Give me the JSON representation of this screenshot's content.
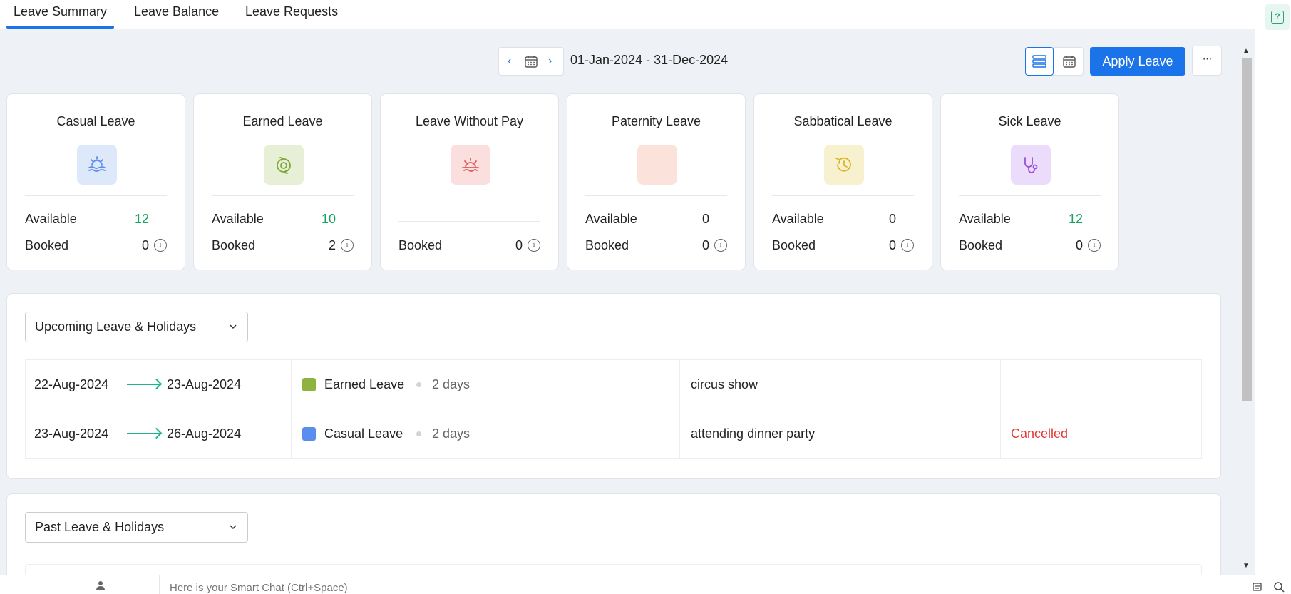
{
  "tabs": [
    {
      "label": "Leave Summary",
      "active": true
    },
    {
      "label": "Leave Balance",
      "active": false
    },
    {
      "label": "Leave Requests",
      "active": false
    }
  ],
  "date_range": "01-Jan-2024 - 31-Dec-2024",
  "apply_label": "Apply Leave",
  "more_label": "···",
  "card_labels": {
    "available": "Available",
    "booked": "Booked"
  },
  "cards": [
    {
      "title": "Casual Leave",
      "icon": "sunrise-waves-icon",
      "icon_bg": "#dde8fb",
      "icon_color": "#5b8def",
      "available": "12",
      "available_color": "green",
      "booked": "0"
    },
    {
      "title": "Earned Leave",
      "icon": "refresh-target-icon",
      "icon_bg": "#e7efd7",
      "icon_color": "#7fa83a",
      "available": "10",
      "available_color": "green",
      "booked": "2"
    },
    {
      "title": "Leave Without Pay",
      "icon": "sunset-icon",
      "icon_bg": "#fbdfdf",
      "icon_color": "#e05a5a",
      "available": null,
      "booked": "0"
    },
    {
      "title": "Paternity Leave",
      "icon": "blank-icon",
      "icon_bg": "#fbe3db",
      "icon_color": "#e8957a",
      "available": "0",
      "available_color": "default",
      "booked": "0"
    },
    {
      "title": "Sabbatical Leave",
      "icon": "clock-rotate-icon",
      "icon_bg": "#f8f1cf",
      "icon_color": "#d9b52a",
      "available": "0",
      "available_color": "default",
      "booked": "0"
    },
    {
      "title": "Sick Leave",
      "icon": "stethoscope-icon",
      "icon_bg": "#ecdcfb",
      "icon_color": "#9b4fd9",
      "available": "12",
      "available_color": "green",
      "booked": "0"
    }
  ],
  "upcoming": {
    "dropdown_label": "Upcoming Leave & Holidays",
    "rows": [
      {
        "from": "22-Aug-2024",
        "to": "23-Aug-2024",
        "type": "Earned Leave",
        "type_color": "#8fb33f",
        "days": "2 days",
        "reason": "circus show",
        "status": ""
      },
      {
        "from": "23-Aug-2024",
        "to": "26-Aug-2024",
        "type": "Casual Leave",
        "type_color": "#5b8def",
        "days": "2 days",
        "reason": "attending dinner party",
        "status": "Cancelled"
      }
    ]
  },
  "past": {
    "dropdown_label": "Past Leave & Holidays"
  },
  "chat": {
    "placeholder": "Here is your Smart Chat (Ctrl+Space)"
  },
  "help_label": "?"
}
